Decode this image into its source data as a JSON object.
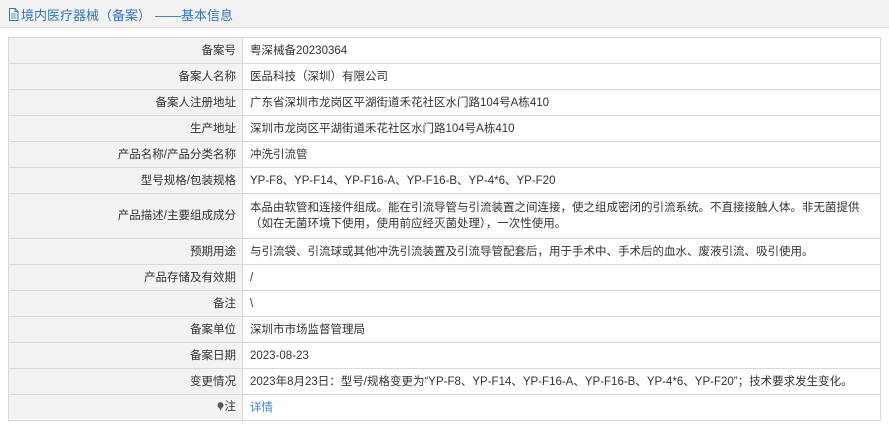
{
  "header": {
    "title": "境内医疗器械（备案）",
    "subtitle": "——基本信息"
  },
  "rows": [
    {
      "label": "备案号",
      "value": "粤深械备20230364"
    },
    {
      "label": "备案人名称",
      "value": "医品科技（深圳）有限公司"
    },
    {
      "label": "备案人注册地址",
      "value": "广东省深圳市龙岗区平湖街道禾花社区水门路104号A栋410"
    },
    {
      "label": "生产地址",
      "value": "深圳市龙岗区平湖街道禾花社区水门路104号A栋410"
    },
    {
      "label": "产品名称/产品分类名称",
      "value": "冲洗引流管"
    },
    {
      "label": "型号规格/包装规格",
      "value": "YP-F8、YP-F14、YP-F16-A、YP-F16-B、YP-4*6、YP-F20"
    },
    {
      "label": "产品描述/主要组成成分",
      "value": "本品由软管和连接件组成。能在引流导管与引流装置之间连接，使之组成密闭的引流系统。不直接接触人体。非无菌提供（如在无菌环境下使用，使用前应经灭菌处理），一次性使用。"
    },
    {
      "label": "预期用途",
      "value": "与引流袋、引流球或其他冲洗引流装置及引流导管配套后，用于手术中、手术后的血水、废液引流、吸引使用。"
    },
    {
      "label": "产品存储及有效期",
      "value": "/"
    },
    {
      "label": "备注",
      "value": "\\"
    },
    {
      "label": "备案单位",
      "value": "深圳市市场监督管理局"
    },
    {
      "label": "备案日期",
      "value": "2023-08-23"
    },
    {
      "label": "变更情况",
      "value": "2023年8月23日：型号/规格变更为“YP-F8、YP-F14、YP-F16-A、YP-F16-B、YP-4*6、YP-F20”；技术要求发生变化。"
    }
  ],
  "note": {
    "label": "注",
    "link_text": "详情",
    "icon": "pin-icon"
  },
  "icons": {
    "header_icon": "document-icon"
  },
  "colors": {
    "header_text": "#3377bb",
    "link": "#3a86d0",
    "label_bg": "#f3f3f3",
    "border": "#d9d9d9"
  }
}
